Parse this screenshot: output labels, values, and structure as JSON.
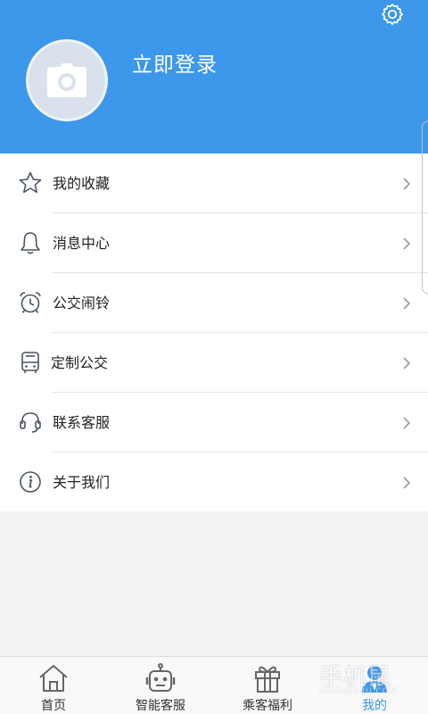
{
  "header": {
    "login_label": "立即登录",
    "background_color": "#3d97ea",
    "avatar_icon": "camera-icon",
    "settings_icon": "gear-icon"
  },
  "menu": {
    "items": [
      {
        "label": "我的收藏",
        "icon": "star-icon"
      },
      {
        "label": "消息中心",
        "icon": "bell-icon"
      },
      {
        "label": "公交闹铃",
        "icon": "alarm-clock-icon"
      },
      {
        "label": "定制公交",
        "icon": "bus-icon"
      },
      {
        "label": "联系客服",
        "icon": "headset-icon"
      },
      {
        "label": "关于我们",
        "icon": "info-icon"
      }
    ]
  },
  "tabbar": {
    "tabs": [
      {
        "label": "首页",
        "icon": "home-icon",
        "active": false
      },
      {
        "label": "智能客服",
        "icon": "robot-icon",
        "active": false
      },
      {
        "label": "乘客福利",
        "icon": "gift-icon",
        "active": false
      },
      {
        "label": "我的",
        "icon": "user-icon",
        "active": true
      }
    ],
    "active_color": "#3d97ea"
  },
  "watermark": {
    "text": "手机鼠",
    "sub": "SHOUJISHU.COM"
  }
}
